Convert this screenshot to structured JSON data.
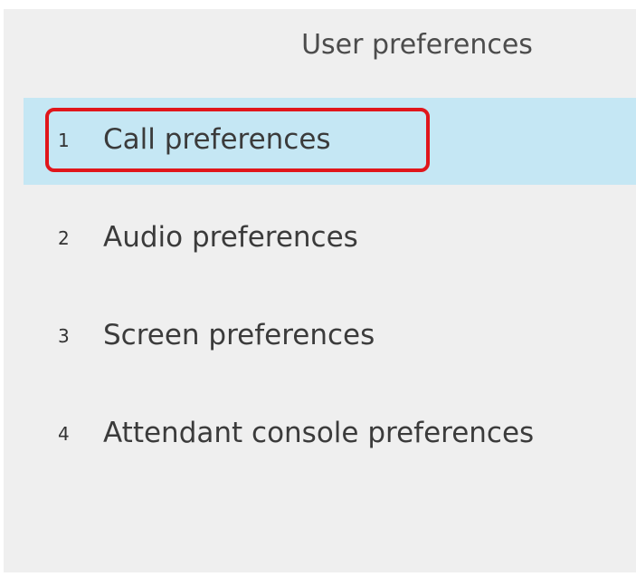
{
  "header": {
    "title": "User preferences"
  },
  "menu": {
    "items": [
      {
        "number": "1",
        "label": "Call preferences",
        "selected": true
      },
      {
        "number": "2",
        "label": "Audio preferences",
        "selected": false
      },
      {
        "number": "3",
        "label": "Screen preferences",
        "selected": false
      },
      {
        "number": "4",
        "label": "Attendant console preferences",
        "selected": false
      }
    ]
  },
  "colors": {
    "screen_background": "#efefef",
    "selected_row": "#c5e7f4",
    "highlight_outline": "#e0161b",
    "text": "#3b3b3b"
  }
}
